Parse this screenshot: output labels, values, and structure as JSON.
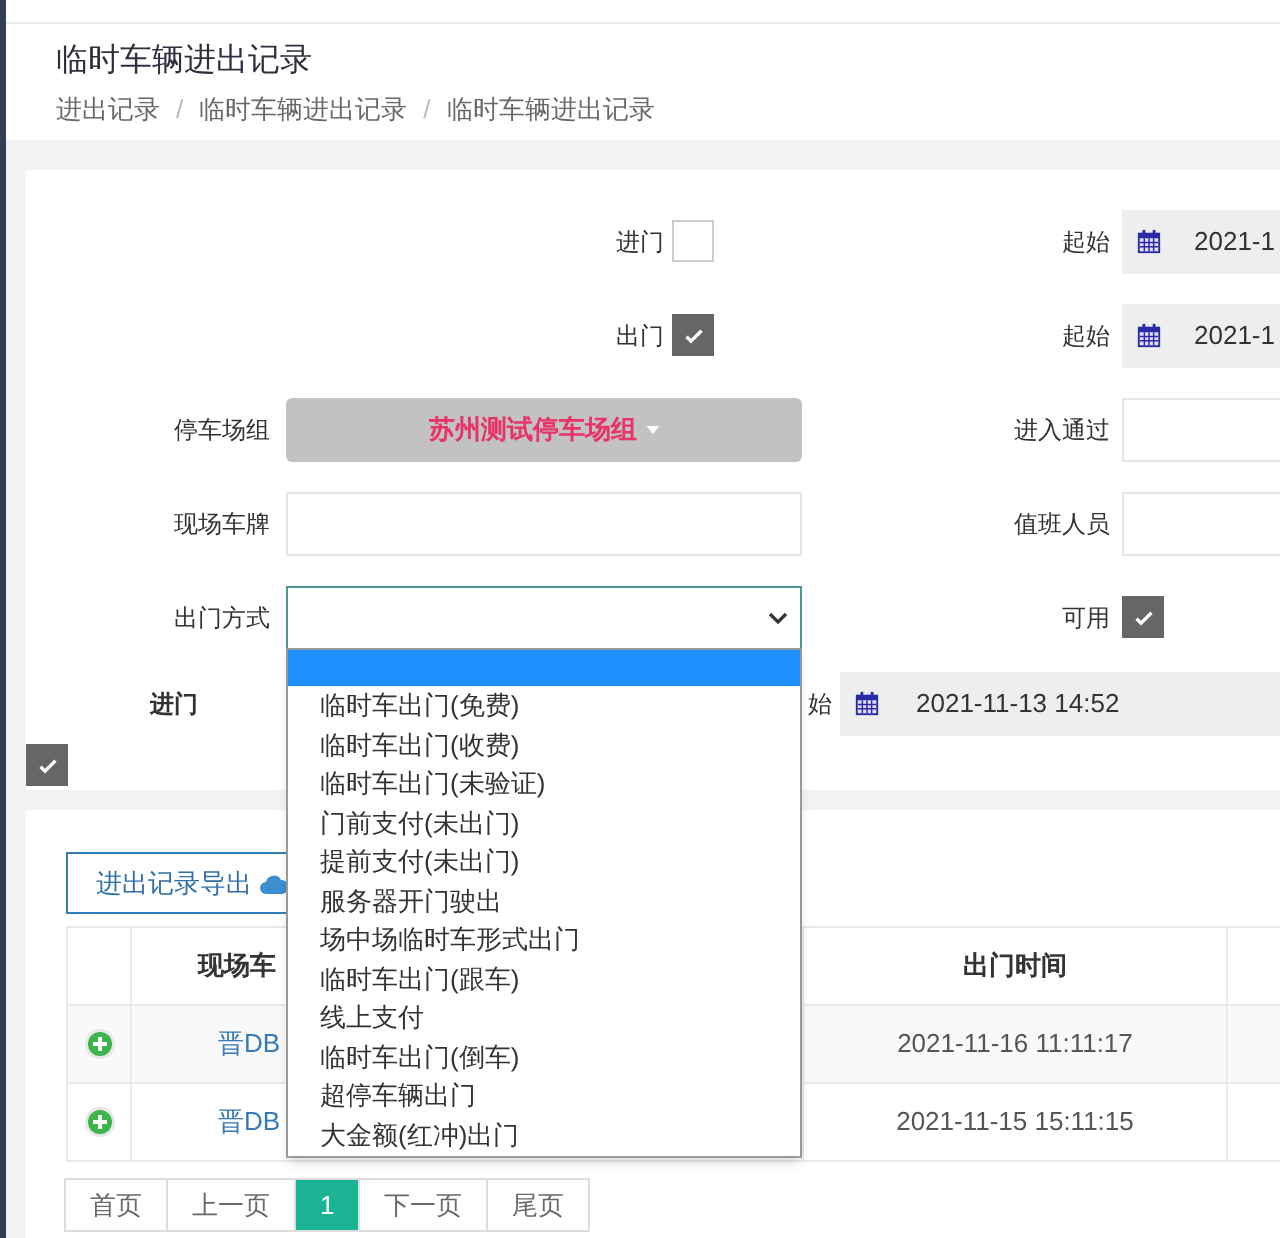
{
  "page_title": "临时车辆进出记录",
  "breadcrumb_separator": "/",
  "breadcrumbs": [
    "进出记录",
    "临时车辆进出记录",
    "临时车辆进出记录"
  ],
  "form": {
    "left": [
      {
        "kind": "checkbox",
        "label": "进门",
        "checked": false
      },
      {
        "kind": "checkbox",
        "label": "出门",
        "checked": true
      },
      {
        "kind": "dropdown",
        "label": "停车场组",
        "value": "苏州测试停车场组"
      },
      {
        "kind": "input",
        "label": "现场车牌"
      },
      {
        "kind": "select",
        "label": "出门方式",
        "focused": true
      }
    ],
    "right": [
      {
        "kind": "date",
        "label": "起始",
        "value": "2021-1"
      },
      {
        "kind": "date",
        "label": "起始",
        "value": "2021-1"
      },
      {
        "kind": "input",
        "label": "进入通过"
      },
      {
        "kind": "input",
        "label": "值班人员"
      },
      {
        "kind": "checkbox",
        "label": "可用",
        "checked": true
      }
    ],
    "entry_row": {
      "label": "进门",
      "date_label": "始",
      "date_value": "2021-11-13 14:52",
      "checked": true
    }
  },
  "select_menu": {
    "blank_option_highlighted": true,
    "options": [
      {
        "label": "临时车出门(免费)",
        "selected": false
      },
      {
        "label": "临时车出门(收费)",
        "selected": false
      },
      {
        "label": "临时车出门(未验证)",
        "selected": false
      },
      {
        "label": "门前支付(未出门)",
        "selected": false
      },
      {
        "label": "提前支付(未出门)",
        "selected": false
      },
      {
        "label": "服务器开门驶出",
        "selected": false
      },
      {
        "label": "场中场临时车形式出门",
        "selected": false
      },
      {
        "label": "临时车出门(跟车)",
        "selected": false
      },
      {
        "label": "线上支付",
        "selected": false
      },
      {
        "label": "临时车出门(倒车)",
        "selected": false
      },
      {
        "label": "超停车辆出门",
        "selected": false
      },
      {
        "label": "大金额(红冲)出门",
        "selected": false
      }
    ]
  },
  "export_button": "进出记录导出",
  "table": {
    "columns": [
      {
        "label": "现场车"
      },
      {
        "label": "出门时间"
      }
    ],
    "rows": [
      {
        "plate": "晋DB",
        "exit_time": "2021-11-16 11:11:17"
      },
      {
        "plate": "晋DB",
        "exit_time": "2021-11-15 15:11:15"
      }
    ]
  },
  "pagination": [
    {
      "label": "首页",
      "selected": false
    },
    {
      "label": "上一页",
      "selected": false
    },
    {
      "label": "1",
      "selected": true
    },
    {
      "label": "下一页",
      "selected": false
    },
    {
      "label": "尾页",
      "selected": false
    }
  ]
}
